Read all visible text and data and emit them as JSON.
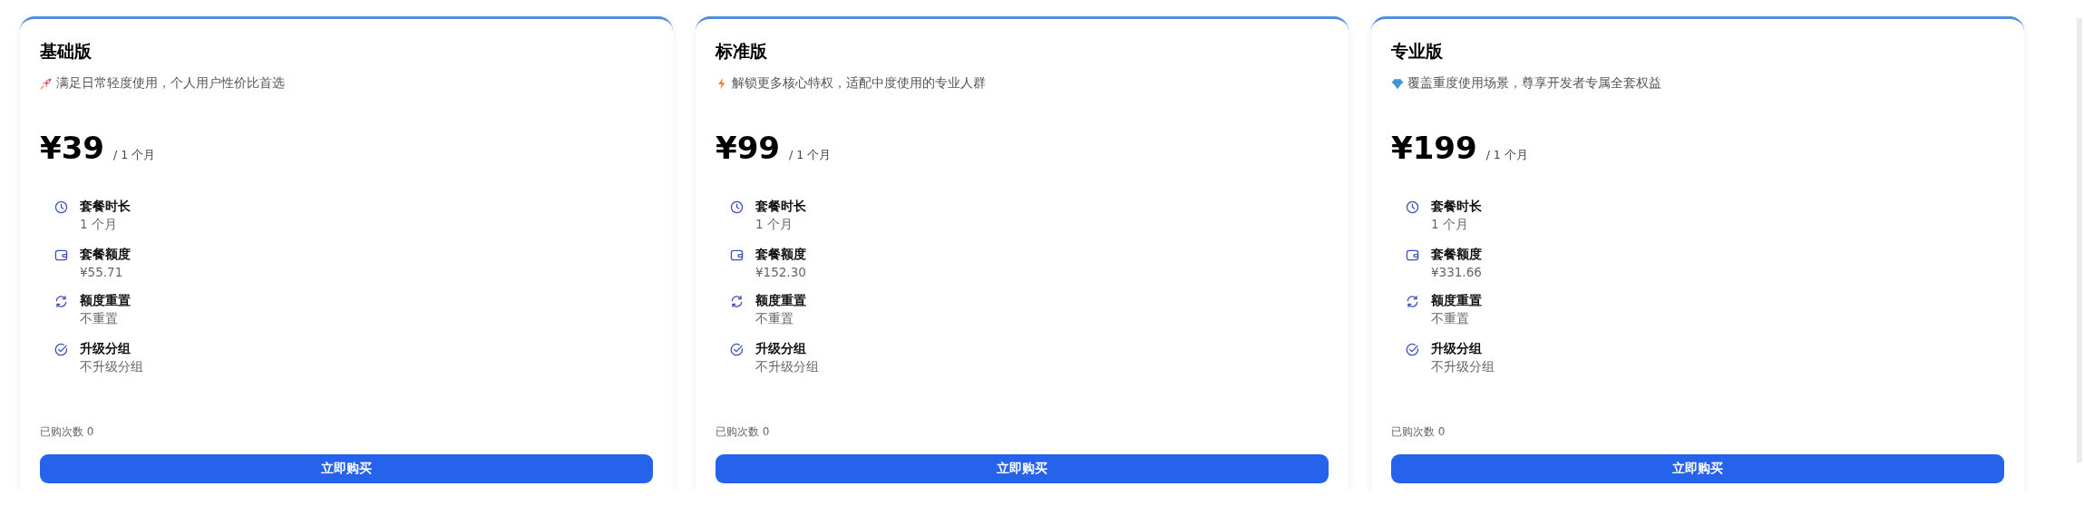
{
  "plans": [
    {
      "name": "基础版",
      "tagline": "满足日常轻度使用，个人用户性价比首选",
      "price": "¥39",
      "period": "/ 1 个月",
      "features": [
        {
          "label": "套餐时长",
          "value": "1 个月"
        },
        {
          "label": "套餐额度",
          "value": "¥55.71"
        },
        {
          "label": "额度重置",
          "value": "不重置"
        },
        {
          "label": "升级分组",
          "value": "不升级分组"
        }
      ],
      "purchases": "已购次数 0",
      "button": "立即购买"
    },
    {
      "name": "标准版",
      "tagline": "解锁更多核心特权，适配中度使用的专业人群",
      "price": "¥99",
      "period": "/ 1 个月",
      "features": [
        {
          "label": "套餐时长",
          "value": "1 个月"
        },
        {
          "label": "套餐额度",
          "value": "¥152.30"
        },
        {
          "label": "额度重置",
          "value": "不重置"
        },
        {
          "label": "升级分组",
          "value": "不升级分组"
        }
      ],
      "purchases": "已购次数 0",
      "button": "立即购买"
    },
    {
      "name": "专业版",
      "tagline": "覆盖重度使用场景，尊享开发者专属全套权益",
      "price": "¥199",
      "period": "/ 1 个月",
      "features": [
        {
          "label": "套餐时长",
          "value": "1 个月"
        },
        {
          "label": "套餐额度",
          "value": "¥331.66"
        },
        {
          "label": "额度重置",
          "value": "不重置"
        },
        {
          "label": "升级分组",
          "value": "不升级分组"
        }
      ],
      "purchases": "已购次数 0",
      "button": "立即购买"
    }
  ]
}
